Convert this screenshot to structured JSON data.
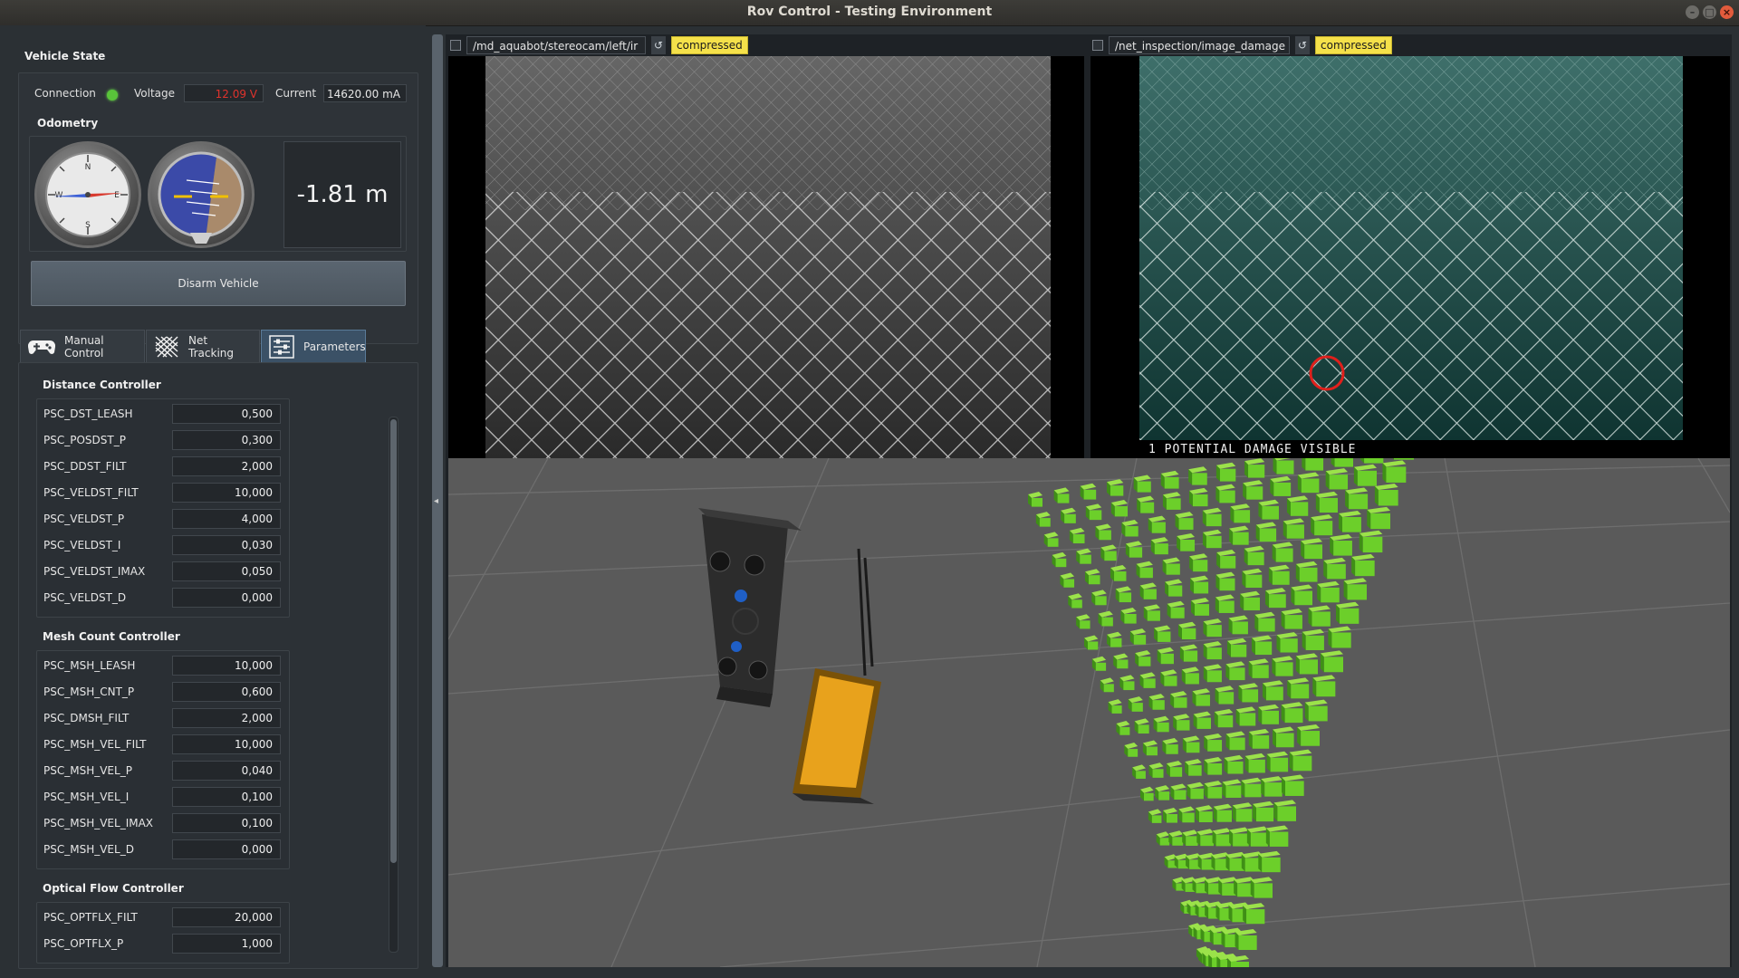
{
  "window": {
    "title": "Rov Control - Testing Environment"
  },
  "vehicle_state": {
    "title": "Vehicle State",
    "connection_label": "Connection",
    "voltage_label": "Voltage",
    "voltage_value": "12.09 V",
    "current_label": "Current",
    "current_value": "14620.00 mA",
    "status_colors": {
      "connection_ok": "#59c43a",
      "voltage_warning": "#e0332c"
    }
  },
  "odometry": {
    "title": "Odometry",
    "depth": "-1.81 m",
    "gauges": [
      "compass-gauge",
      "attitude-gauge"
    ]
  },
  "disarm_label": "Disarm Vehicle",
  "tabs": [
    {
      "label": "Manual Control",
      "icon": "gamepad-icon"
    },
    {
      "label": "Net Tracking",
      "icon": "net-icon"
    },
    {
      "label": "Parameters",
      "icon": "sliders-icon",
      "active": true
    }
  ],
  "parameters": {
    "groups": [
      {
        "title": "Distance Controller",
        "params": [
          {
            "name": "PSC_DST_LEASH",
            "value": "0,500"
          },
          {
            "name": "PSC_POSDST_P",
            "value": "0,300"
          },
          {
            "name": "PSC_DDST_FILT",
            "value": "2,000"
          },
          {
            "name": "PSC_VELDST_FILT",
            "value": "10,000"
          },
          {
            "name": "PSC_VELDST_P",
            "value": "4,000"
          },
          {
            "name": "PSC_VELDST_I",
            "value": "0,030"
          },
          {
            "name": "PSC_VELDST_IMAX",
            "value": "0,050"
          },
          {
            "name": "PSC_VELDST_D",
            "value": "0,000"
          }
        ]
      },
      {
        "title": "Mesh Count Controller",
        "params": [
          {
            "name": "PSC_MSH_LEASH",
            "value": "10,000"
          },
          {
            "name": "PSC_MSH_CNT_P",
            "value": "0,600"
          },
          {
            "name": "PSC_DMSH_FILT",
            "value": "2,000"
          },
          {
            "name": "PSC_MSH_VEL_FILT",
            "value": "10,000"
          },
          {
            "name": "PSC_MSH_VEL_P",
            "value": "0,040"
          },
          {
            "name": "PSC_MSH_VEL_I",
            "value": "0,100"
          },
          {
            "name": "PSC_MSH_VEL_IMAX",
            "value": "0,100"
          },
          {
            "name": "PSC_MSH_VEL_D",
            "value": "0,000"
          }
        ]
      },
      {
        "title": "Optical Flow Controller",
        "params": [
          {
            "name": "PSC_OPTFLX_FILT",
            "value": "20,000"
          },
          {
            "name": "PSC_OPTFLX_P",
            "value": "1,000"
          }
        ]
      }
    ]
  },
  "camera_left": {
    "topic": "/md_aquabot/stereocam/left/ir",
    "transport": "compressed"
  },
  "camera_right": {
    "topic": "/net_inspection/image_damage",
    "transport": "compressed",
    "overlay": "1 POTENTIAL DAMAGE VISIBLE"
  },
  "colors": {
    "accent_tab": "#3b5166",
    "badge": "#f5e14a",
    "markers": "#6ccf2a",
    "rov_orange": "#e8a21c"
  }
}
